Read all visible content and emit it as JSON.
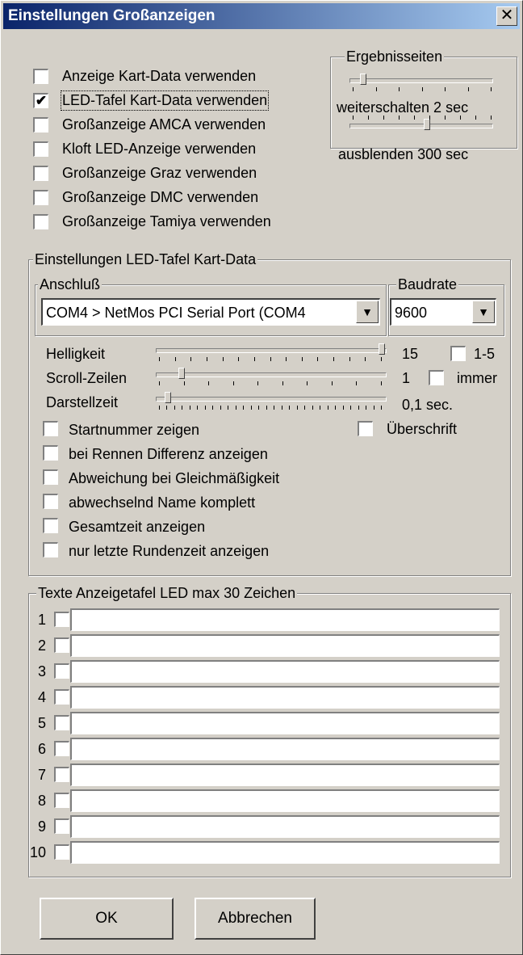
{
  "window": {
    "title": "Einstellungen Großanzeigen",
    "close_glyph": "✕"
  },
  "display_options": [
    {
      "label": "Anzeige Kart-Data verwenden",
      "checked": false
    },
    {
      "label": "LED-Tafel Kart-Data verwenden",
      "checked": true
    },
    {
      "label": "Großanzeige AMCA verwenden",
      "checked": false
    },
    {
      "label": "Kloft LED-Anzeige verwenden",
      "checked": false
    },
    {
      "label": "Großanzeige Graz verwenden",
      "checked": false
    },
    {
      "label": "Großanzeige DMC verwenden",
      "checked": false
    },
    {
      "label": "Großanzeige Tamiya verwenden",
      "checked": false
    }
  ],
  "ergebnisseiten": {
    "title": "Ergebnisseiten",
    "weiterschalten_label": "weiterschalten 2 sec",
    "weiterschalten_level": 0.08,
    "ausblenden_label": "ausblenden 300 sec",
    "ausblenden_level": 0.55
  },
  "led_settings": {
    "title": "Einstellungen LED-Tafel Kart-Data",
    "anschluss_title": "Anschluß",
    "port_value": "COM4  > NetMos PCI Serial Port (COM4",
    "baudrate_title": "Baudrate",
    "baudrate_value": "9600",
    "helligkeit_label": "Helligkeit",
    "helligkeit_value": "15",
    "helligkeit_level": 1.0,
    "range_label": "1-5",
    "scroll_label": "Scroll-Zeilen",
    "scroll_value": "1",
    "scroll_level": 0.1,
    "immer_label": "immer",
    "darstell_label": "Darstellzeit",
    "darstell_value": "0,1 sec.",
    "darstell_level": 0.04,
    "ueberschrift_label": "Überschrift",
    "options": [
      {
        "label": "Startnummer zeigen"
      },
      {
        "label": "bei Rennen Differenz anzeigen"
      },
      {
        "label": "Abweichung bei Gleichmäßigkeit"
      },
      {
        "label": "abwechselnd Name komplett"
      },
      {
        "label": "Gesamtzeit anzeigen"
      },
      {
        "label": "nur letzte Rundenzeit anzeigen"
      }
    ]
  },
  "texte": {
    "title": "Texte Anzeigetafel LED  max 30 Zeichen",
    "rows": [
      "1",
      "2",
      "3",
      "4",
      "5",
      "6",
      "7",
      "8",
      "9",
      "10"
    ]
  },
  "buttons": {
    "ok": "OK",
    "cancel": "Abbrechen"
  }
}
